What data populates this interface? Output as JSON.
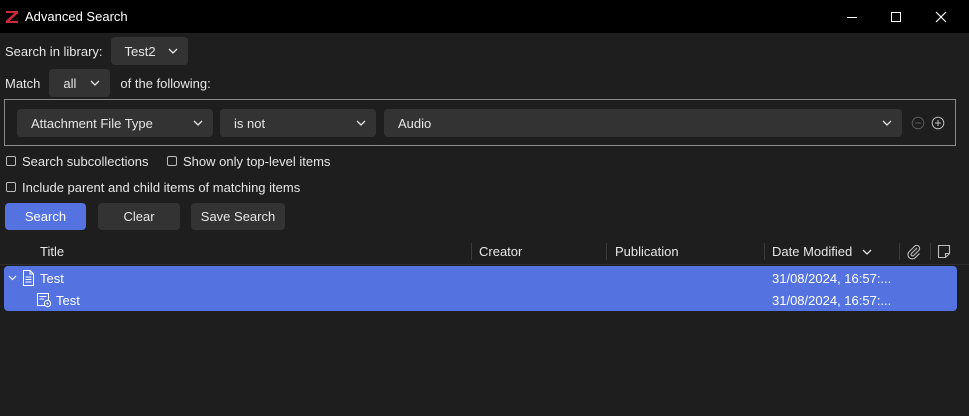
{
  "window": {
    "title": "Advanced Search",
    "minimize_icon": "minimize-icon",
    "maximize_icon": "maximize-icon",
    "close_icon": "close-icon"
  },
  "search_in": {
    "label": "Search in library:",
    "value": "Test2"
  },
  "match": {
    "label": "Match",
    "value": "all",
    "suffix": "of the following:"
  },
  "condition": {
    "field": "Attachment File Type",
    "operator": "is not",
    "value": "Audio"
  },
  "options": {
    "search_subcollections": "Search subcollections",
    "show_top_level": "Show only top-level items",
    "include_parent_child": "Include parent and child items of matching items"
  },
  "buttons": {
    "search": "Search",
    "clear": "Clear",
    "save_search": "Save Search"
  },
  "columns": {
    "title": "Title",
    "creator": "Creator",
    "publication": "Publication",
    "date_modified": "Date Modified"
  },
  "results": [
    {
      "title": "Test",
      "date": "31/08/2024, 16:57:..."
    },
    {
      "title": "Test",
      "date": "31/08/2024, 16:57:..."
    }
  ],
  "colors": {
    "accent": "#5473e0",
    "logo": "#cc2936",
    "background": "#1e1e1e"
  }
}
